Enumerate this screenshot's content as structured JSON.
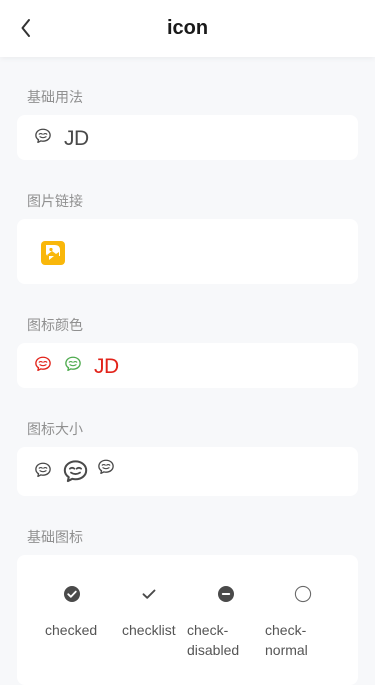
{
  "header": {
    "title": "icon",
    "back_icon": "chevron-left-icon"
  },
  "sections": {
    "basic": {
      "label": "基础用法",
      "icon": "message-icon",
      "jd_text": "JD"
    },
    "image_link": {
      "label": "图片链接",
      "icon": "image-link-icon"
    },
    "colors": {
      "label": "图标颜色",
      "icon_colors": [
        "#e2231a",
        "#4fab4f"
      ],
      "jd_text": "JD",
      "jd_color": "#e2231a"
    },
    "sizes": {
      "label": "图标大小",
      "icon": "message-icon"
    },
    "basic_icons": {
      "label": "基础图标",
      "items": [
        {
          "icon": "checked-icon",
          "name": "checked"
        },
        {
          "icon": "checklist-icon",
          "name": "checklist"
        },
        {
          "icon": "check-disabled-icon",
          "name": "check-\ndisabled"
        },
        {
          "icon": "check-normal-icon",
          "name": "check-\nnormal"
        }
      ]
    }
  },
  "colors": {
    "icon_default": "#4a4a4a",
    "label_gray": "#909090",
    "image_icon_bg": "#f9b70a",
    "background": "#f7f8fa"
  }
}
